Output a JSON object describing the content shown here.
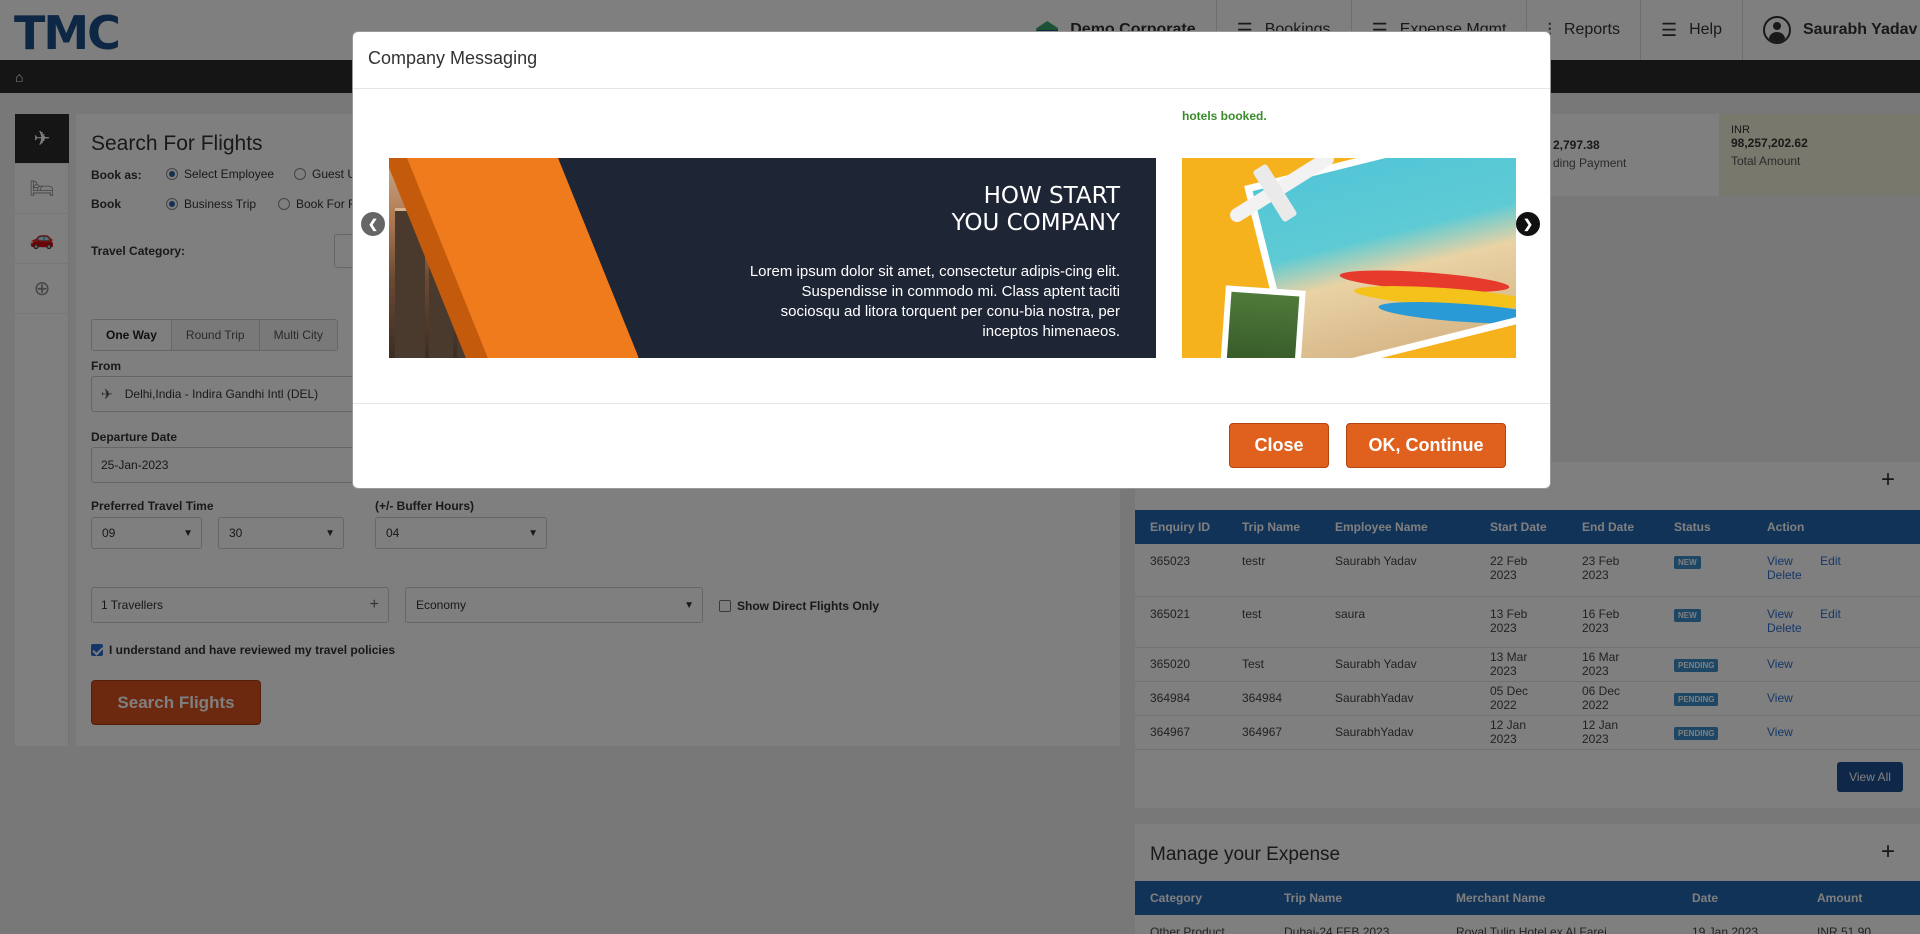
{
  "header": {
    "logo": "TMC",
    "org_name": "Demo Corporate",
    "nav": [
      {
        "label": "Bookings",
        "icon": "list-icon"
      },
      {
        "label": "Expense Mgmt",
        "icon": "list-icon"
      },
      {
        "label": "Reports",
        "icon": "chart-icon"
      },
      {
        "label": "Help",
        "icon": "list-icon"
      }
    ],
    "user_name": "Saurabh Yadav"
  },
  "search": {
    "title": "Search For Flights",
    "book_as_label": "Book as:",
    "book_as_options": [
      "Select Employee",
      "Guest U"
    ],
    "book_label": "Book",
    "book_options": [
      "Business Trip",
      "Book For F"
    ],
    "travel_category_label": "Travel Category:",
    "trip_types": [
      "One Way",
      "Round Trip",
      "Multi City"
    ],
    "from_label": "From",
    "from_value": "Delhi,India - Indira Gandhi Intl (DEL)",
    "departure_label": "Departure Date",
    "departure_value": "25-Jan-2023",
    "pref_time_label": "Preferred Travel Time",
    "buffer_label": "(+/- Buffer Hours)",
    "hour": "09",
    "minute": "30",
    "buffer": "04",
    "travellers": "1 Travellers",
    "cabin": "Economy",
    "direct_label": "Show Direct Flights Only",
    "policy_label": "I understand and have reviewed my travel policies",
    "search_button": "Search Flights"
  },
  "stats": [
    {
      "value": "2,797.38",
      "label": "ding Payment"
    },
    {
      "currency": "INR",
      "value": "98,257,202.62",
      "label": "Total Amount"
    }
  ],
  "trips": {
    "columns": [
      "Enquiry ID",
      "Trip Name",
      "Employee Name",
      "Start Date",
      "End Date",
      "Status",
      "Action"
    ],
    "rows": [
      {
        "id": "365023",
        "name": "testr",
        "employee": "Saurabh Yadav",
        "start": "22 Feb 2023",
        "end": "23 Feb 2023",
        "status": "NEW",
        "actions": [
          "View",
          "Edit",
          "Delete"
        ]
      },
      {
        "id": "365021",
        "name": "test",
        "employee": "saura",
        "start": "13 Feb 2023",
        "end": "16 Feb 2023",
        "status": "NEW",
        "actions": [
          "View",
          "Edit",
          "Delete"
        ]
      },
      {
        "id": "365020",
        "name": "Test",
        "employee": "Saurabh Yadav",
        "start": "13 Mar 2023",
        "end": "16 Mar 2023",
        "status": "PENDING",
        "actions": [
          "View"
        ]
      },
      {
        "id": "364984",
        "name": "364984",
        "employee": "SaurabhYadav",
        "start": "05 Dec 2022",
        "end": "06 Dec 2022",
        "status": "PENDING",
        "actions": [
          "View"
        ]
      },
      {
        "id": "364967",
        "name": "364967",
        "employee": "SaurabhYadav",
        "start": "12 Jan 2023",
        "end": "12 Jan 2023",
        "status": "PENDING",
        "actions": [
          "View"
        ]
      }
    ],
    "view_all": "View All"
  },
  "expense": {
    "title": "Manage your Expense",
    "columns": [
      "Category",
      "Trip Name",
      "Merchant Name",
      "Date",
      "Amount"
    ],
    "rows": [
      {
        "category": "Other Product",
        "trip": "Dubai-24 FEB 2023",
        "merchant": "Royal Tulip Hotel ex Al Farej",
        "date": "19 Jan 2023",
        "amount": "INR 51.90"
      }
    ]
  },
  "modal": {
    "title": "Company Messaging",
    "slide_caption": "hotels booked.",
    "banner_title_line1": "HOW START",
    "banner_title_line2": "YOU COMPANY",
    "banner_body": "Lorem ipsum dolor sit amet, consectetur adipis-cing elit. Suspendisse in commodo mi. Class aptent taciti sociosqu ad litora torquent per conu-bia nostra, per inceptos himenaeos.",
    "close_button": "Close",
    "continue_button": "OK, Continue"
  },
  "colors": {
    "brand": "#1d4f8a",
    "accent": "#d9531e",
    "table_header": "#2466b0"
  }
}
